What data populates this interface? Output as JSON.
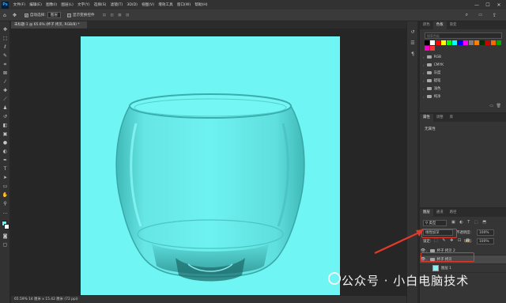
{
  "app": {
    "logo": "Ps"
  },
  "menu": [
    "文件(F)",
    "编辑(E)",
    "图像(I)",
    "图层(L)",
    "文字(Y)",
    "选择(S)",
    "滤镜(T)",
    "3D(D)",
    "视图(V)",
    "增效工具",
    "窗口(W)",
    "帮助(H)"
  ],
  "window_controls": {
    "minimize": "—",
    "maximize": "☐",
    "close": "✕"
  },
  "options_bar": {
    "auto_select_label": "自动选择:",
    "auto_select_value": "图层",
    "transform_label": "显示变换控件"
  },
  "document": {
    "tab_label": "未标题-1 @ 65.6% (杯子 拷贝, RGB/8) *",
    "status": "65.59%  14 厘米 x 15.42 厘米 (72 ppi)"
  },
  "swatches_panel": {
    "tabs": [
      "颜色",
      "色板",
      "渐变"
    ],
    "active_tab": "色板",
    "search_placeholder": "搜索色板",
    "colors": [
      "#000000",
      "#ffffff",
      "#ff0000",
      "#ffff00",
      "#00ff00",
      "#00ffff",
      "#0000ff",
      "#ff00ff",
      "#7f7f7f",
      "#ff7f00",
      "#003300",
      "#cc0000",
      "#ff6600",
      "#00aa00",
      "#ff00cc",
      "#ff3333"
    ],
    "folders": [
      "RGB",
      "CMYK",
      "灰度",
      "蜡笔",
      "浅色",
      "纯净"
    ]
  },
  "properties_panel": {
    "tabs": [
      "属性",
      "调整",
      "库"
    ],
    "active_tab": "属性",
    "empty_text": "无属性"
  },
  "layers_panel": {
    "tabs": [
      "图层",
      "通道",
      "路径"
    ],
    "active_tab": "图层",
    "kind_filter": "类型",
    "blend_mode": "线性加深",
    "opacity_label": "不透明度:",
    "opacity_value": "100%",
    "lock_label": "锁定:",
    "fill_label": "填充:",
    "fill_value": "100%",
    "layers": [
      {
        "name": "杯子 拷贝 2",
        "selected": false
      },
      {
        "name": "杯子 拷贝",
        "selected": true
      },
      {
        "name": "图层 1",
        "selected": false
      }
    ]
  },
  "watermark": "公众号 · 小白电脑技术"
}
